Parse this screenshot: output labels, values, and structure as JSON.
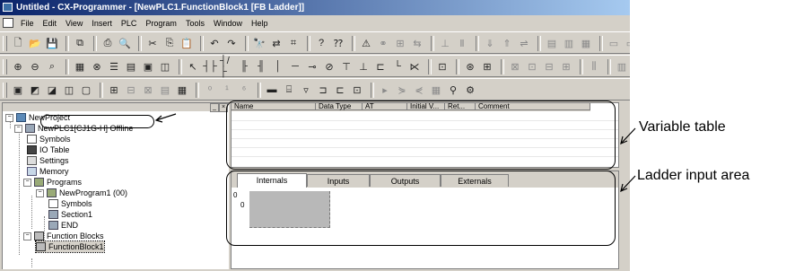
{
  "window": {
    "title": "Untitled - CX-Programmer - [NewPLC1.FunctionBlock1 [FB Ladder]]"
  },
  "menu": [
    "File",
    "Edit",
    "View",
    "Insert",
    "PLC",
    "Program",
    "Tools",
    "Window",
    "Help"
  ],
  "tree": {
    "project": "NewProject",
    "plc": "NewPLC1[CJ1G-H] Offline",
    "symbols": "Symbols",
    "io_table": "IO Table",
    "settings": "Settings",
    "memory": "Memory",
    "programs": "Programs",
    "program1": "NewProgram1 (00)",
    "prog_symbols": "Symbols",
    "section1": "Section1",
    "end": "END",
    "function_blocks": "Function Blocks",
    "fb1": "FunctionBlock1"
  },
  "variable_table": {
    "columns": [
      "Name",
      "Data Type",
      "AT",
      "Initial V...",
      "Ret...",
      "Comment"
    ]
  },
  "ladder": {
    "tabs": [
      "Internals",
      "Inputs",
      "Outputs",
      "Externals"
    ],
    "active_tab": "Internals",
    "rung_label": "0",
    "rung_step": "0"
  },
  "annotations": {
    "variable_table": "Variable table",
    "ladder_input_area": "Ladder input area"
  }
}
